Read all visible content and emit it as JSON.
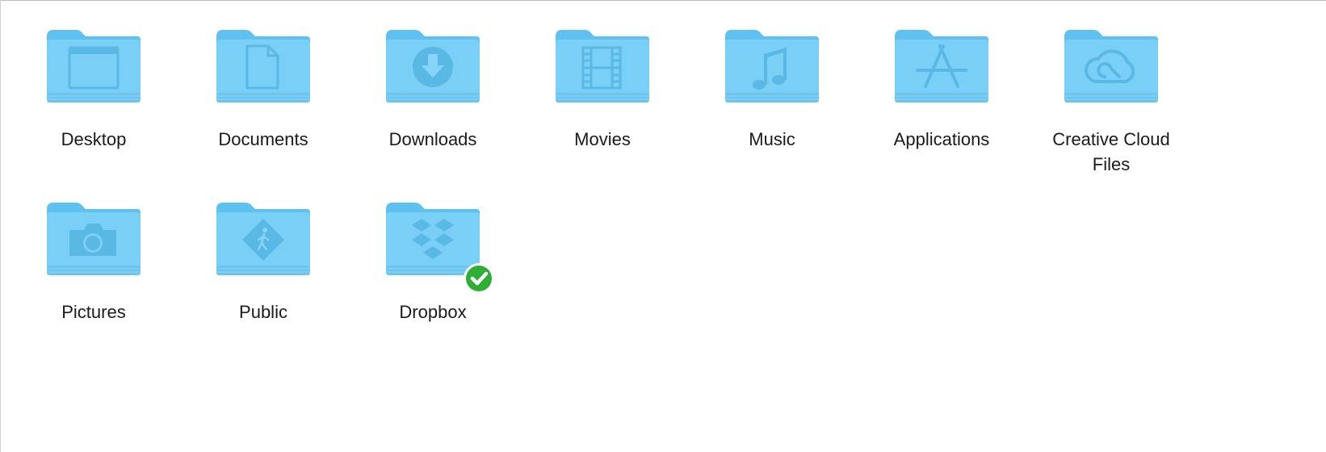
{
  "window": {
    "view": "icon-view"
  },
  "colors": {
    "folder_back": "#5fc1ef",
    "folder_front": "#7dd2f7",
    "folder_glyph": "#5ab8e4",
    "badge_green": "#2fae35"
  },
  "items": [
    {
      "label": "Desktop",
      "icon": "desktop-icon"
    },
    {
      "label": "Documents",
      "icon": "document-icon"
    },
    {
      "label": "Downloads",
      "icon": "download-arrow-icon"
    },
    {
      "label": "Movies",
      "icon": "film-strip-icon"
    },
    {
      "label": "Music",
      "icon": "music-note-icon"
    },
    {
      "label": "Applications",
      "icon": "app-store-a-icon"
    },
    {
      "label": "Creative Cloud Files",
      "label_line1": "Creative Cloud",
      "label_line2": "Files",
      "icon": "creative-cloud-icon"
    },
    {
      "label": "Pictures",
      "icon": "camera-icon"
    },
    {
      "label": "Public",
      "icon": "pedestrian-sign-icon"
    },
    {
      "label": "Dropbox",
      "icon": "dropbox-icon",
      "sync_status": "synced",
      "badge_icon": "checkmark-badge-icon"
    }
  ]
}
